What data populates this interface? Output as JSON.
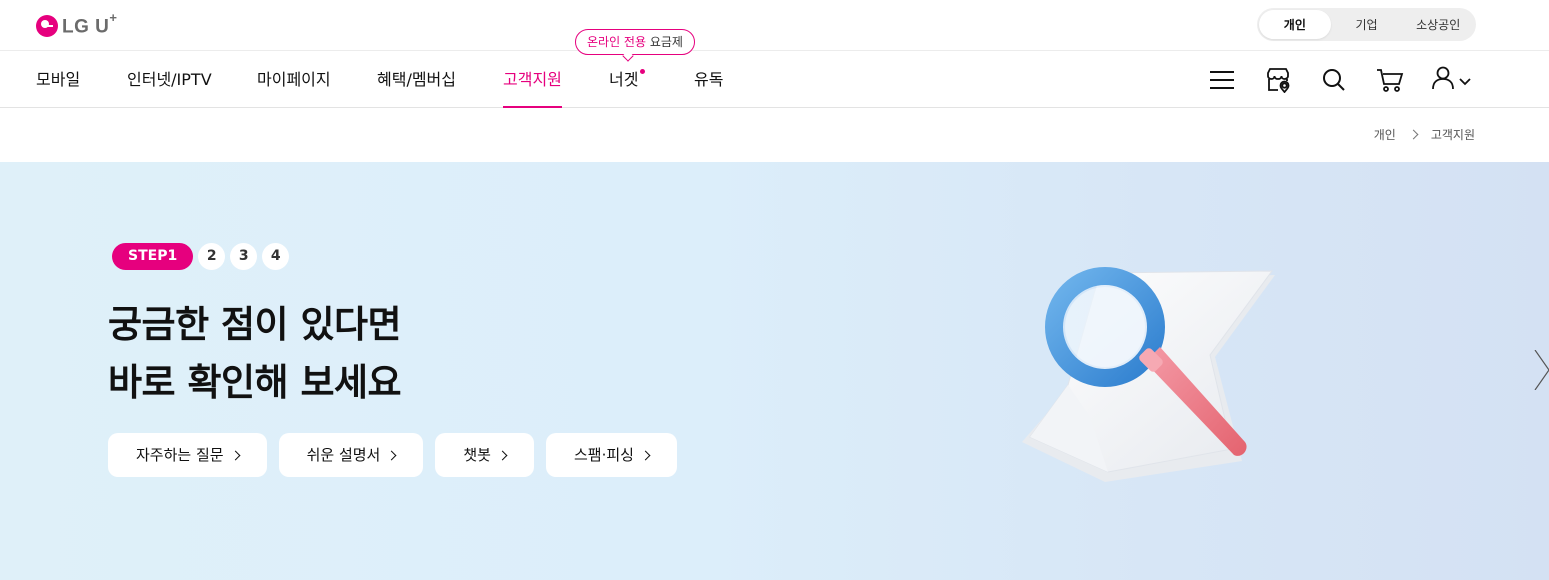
{
  "brand": {
    "logo_text": "LG U",
    "logo_sup": "+"
  },
  "segment": {
    "items": [
      "개인",
      "기업",
      "소상공인"
    ],
    "active": "개인"
  },
  "nav": {
    "items": [
      "모바일",
      "인터넷/IPTV",
      "마이페이지",
      "혜택/멤버십",
      "고객지원",
      "너겟",
      "유독"
    ],
    "active": "고객지원"
  },
  "promo_bubble": {
    "highlight": "온라인 전용",
    "text": "요금제"
  },
  "header_icons": [
    "menu-icon",
    "store-location-icon",
    "search-icon",
    "cart-icon",
    "user-icon",
    "chevron-down-icon"
  ],
  "breadcrumb": [
    "개인",
    "고객지원"
  ],
  "hero": {
    "steps": {
      "active": "STEP1",
      "others": [
        "2",
        "3",
        "4"
      ]
    },
    "headline": [
      "궁금한 점이 있다면",
      "바로 확인해 보세요"
    ],
    "buttons": [
      "자주하는 질문",
      "쉬운 설명서",
      "챗봇",
      "스팸·피싱"
    ]
  },
  "colors": {
    "accent": "#e6007e",
    "hero_bg": "#dceefa"
  }
}
